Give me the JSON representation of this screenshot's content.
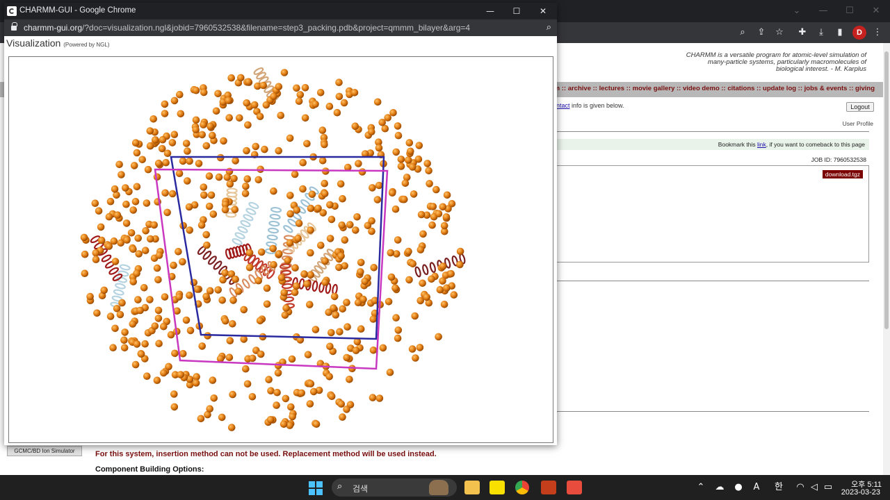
{
  "popup": {
    "title": "CHARMM-GUI - Google Chrome",
    "url_host": "charmm-gui.org",
    "url_rest": "/?doc=visualization.ngl&jobid=7960532538&filename=step3_packing.pdb&project=qmmm_bilayer&arg=4",
    "viz_title": "Visualization",
    "viz_powered": "(Powered by NGL)"
  },
  "background": {
    "quote_line1": "CHARMM is a versatile program for atomic-level simulation of",
    "quote_line2": "many-particle systems, particularly macromolecules of",
    "quote_line3": "biological interest. - M. Karplus",
    "nav_links": ":: forum :: archive :: lectures :: movie gallery :: video demo :: citations :: update log :: jobs & events :: giving",
    "contact_link": "ntact",
    "contact_rest": " info is given below.",
    "logout": "Logout",
    "user_profile": "User Profile",
    "bookmark_pre": "Bookmark this ",
    "bookmark_link": "link",
    "bookmark_post": ", if you want to comeback to this page",
    "job_id": "JOB ID: 7960532538",
    "download": "download.tgz",
    "sim_button": "GCMC/BD Ion Simulator",
    "insertion_msg": "For this system, insertion method can not be used. Replacement method will be used instead.",
    "component_opts": "Component Building Options:",
    "profile_initial": "D"
  },
  "taskbar": {
    "search_label": "검색",
    "time": "오후 5:11",
    "date": "2023-03-23",
    "lang": "A",
    "ime": "한"
  },
  "icons": {
    "minimize": "—",
    "maximize": "☐",
    "close": "✕",
    "zoom": "⌕",
    "search": "⌕"
  },
  "colors": {
    "lipid_atom": "#e07b12",
    "box_primary": "#2a2aa0",
    "box_secondary": "#c838c0",
    "nav_text": "#7a1010"
  }
}
